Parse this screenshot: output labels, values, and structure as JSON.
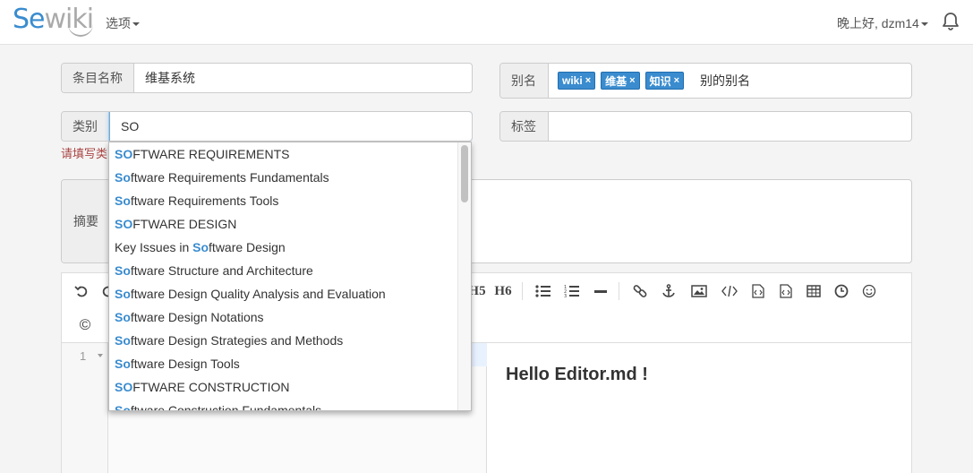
{
  "navbar": {
    "logo_se": "Se",
    "logo_wiki": "wiki",
    "options_label": "选项",
    "greeting": "晚上好, dzm14"
  },
  "form": {
    "name": {
      "label": "条目名称",
      "value": "维基系统"
    },
    "alias": {
      "label": "别名",
      "tags": [
        "wiki",
        "维基",
        "知识"
      ],
      "input_value": "别的别名"
    },
    "category": {
      "label": "类别",
      "value": "SO"
    },
    "tags": {
      "label": "标签",
      "value": ""
    },
    "error": "请填写类",
    "summary": {
      "label": "摘要"
    }
  },
  "autocomplete": {
    "items": [
      {
        "match": "SO",
        "rest": "FTWARE REQUIREMENTS",
        "prefix": ""
      },
      {
        "match": "So",
        "rest": "ftware Requirements Fundamentals",
        "prefix": ""
      },
      {
        "match": "So",
        "rest": "ftware Requirements Tools",
        "prefix": ""
      },
      {
        "match": "SO",
        "rest": "FTWARE DESIGN",
        "prefix": ""
      },
      {
        "match": "So",
        "rest": "ftware Design",
        "prefix": "Key Issues in "
      },
      {
        "match": "So",
        "rest": "ftware Structure and Architecture",
        "prefix": ""
      },
      {
        "match": "So",
        "rest": "ftware Design Quality Analysis and Evaluation",
        "prefix": ""
      },
      {
        "match": "So",
        "rest": "ftware Design Notations",
        "prefix": ""
      },
      {
        "match": "So",
        "rest": "ftware Design Strategies and Methods",
        "prefix": ""
      },
      {
        "match": "So",
        "rest": "ftware Design Tools",
        "prefix": ""
      },
      {
        "match": "SO",
        "rest": "FTWARE CONSTRUCTION",
        "prefix": ""
      },
      {
        "match": "So",
        "rest": "ftware Construction Fundamentals",
        "prefix": ""
      }
    ]
  },
  "editor": {
    "toolbar": {
      "h5": "H5",
      "h6": "H6"
    },
    "line_number": "1",
    "preview_heading": "Hello Editor.md !"
  },
  "colors": {
    "accent": "#3a8ccf",
    "error": "#a94442"
  }
}
